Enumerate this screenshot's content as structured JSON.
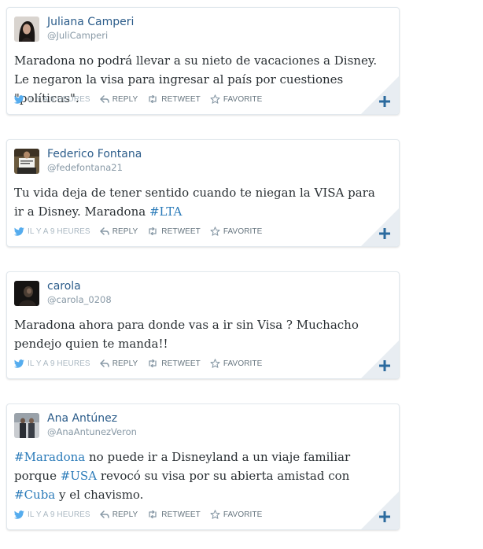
{
  "tweets": [
    {
      "name": "Juliana Camperi",
      "handle": "@JuliCamperi",
      "text": [
        {
          "t": "Maradona no podrá llevar a su nieto de vacaciones a Disney. Le negaron la visa para ingresar al país por cuestiones \"políticas\".",
          "tag": false
        }
      ]
    },
    {
      "name": "Federico Fontana",
      "handle": "@fedefontana21",
      "text": [
        {
          "t": "Tu vida deja de tener sentido cuando te niegan la VISA para ir a Disney. Maradona ",
          "tag": false
        },
        {
          "t": "#LTA",
          "tag": true
        }
      ]
    },
    {
      "name": "carola",
      "handle": "@carola_0208",
      "text": [
        {
          "t": "Maradona ahora para donde vas a ir sin Visa ? Muchacho pendejo quien te manda!!",
          "tag": false
        }
      ]
    },
    {
      "name": "Ana Antúnez",
      "handle": "@AnaAntunezVeron",
      "text": [
        {
          "t": "#Maradona",
          "tag": true
        },
        {
          "t": " no puede ir a Disneyland a un viaje familiar porque ",
          "tag": false
        },
        {
          "t": "#USA",
          "tag": true
        },
        {
          "t": " revocó su visa por su abierta amistad con ",
          "tag": false
        },
        {
          "t": "#Cuba",
          "tag": true
        },
        {
          "t": " y el chavismo.",
          "tag": false
        }
      ]
    }
  ],
  "actions": {
    "time": "IL Y A 9 HEURES",
    "reply": "REPLY",
    "retweet": "RETWEET",
    "favorite": "FAVORITE"
  },
  "colors": {
    "name": "#2b5c8a",
    "hashtag": "#2b7bb9",
    "twitter_bird": "#55acee",
    "action_icon": "#8899a6",
    "plus": "#2b6a9e"
  }
}
